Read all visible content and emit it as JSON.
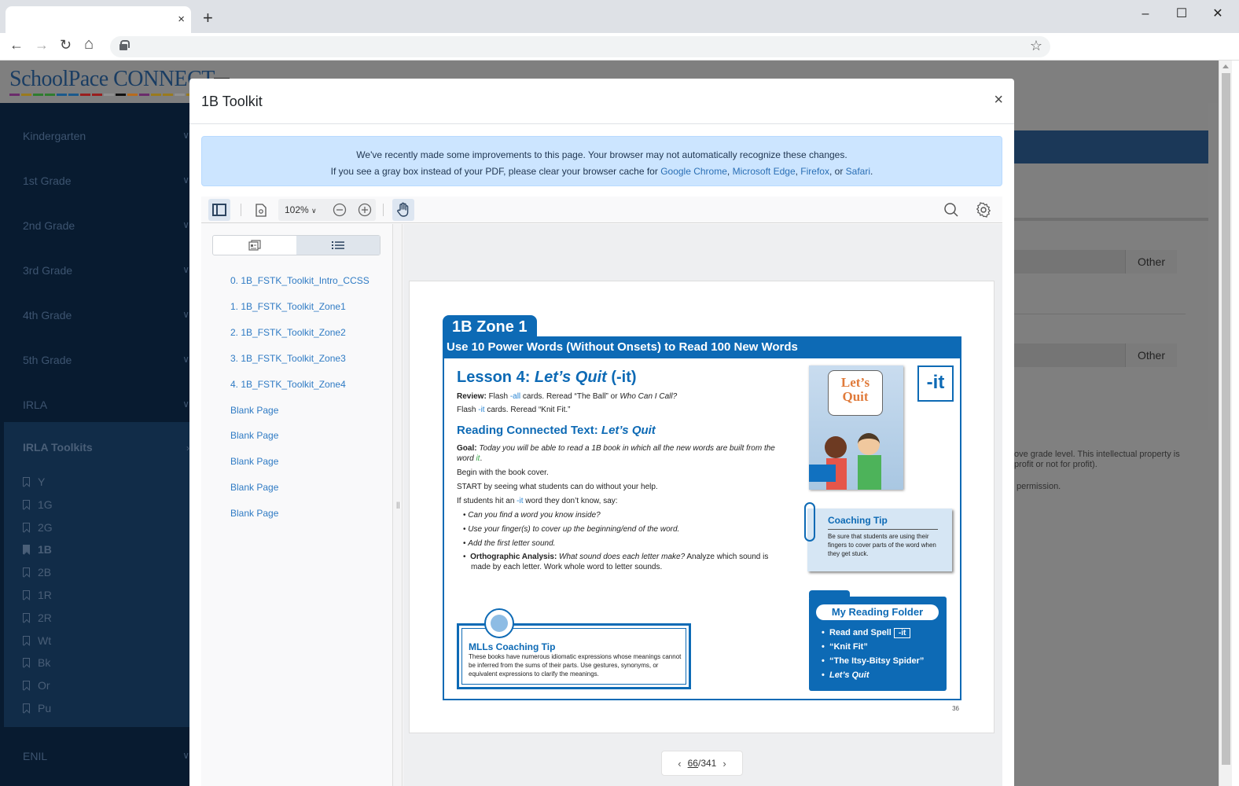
{
  "browser": {
    "tab_title": "",
    "tab_close_icon": "×",
    "new_tab_icon": "+",
    "window_controls": {
      "minimize": "–",
      "maximize": "☐",
      "close": "✕"
    },
    "nav": {
      "back": "←",
      "forward": "→",
      "reload": "↻",
      "home": "⌂"
    },
    "address": "",
    "bookmark_icon": "☆"
  },
  "app": {
    "logo_text": "SchoolPace CONNECT",
    "logo_stripe_colors": [
      "#6b2c6b",
      "#9a7a1e",
      "#2f7d2f",
      "#2f7d2f",
      "#1b5a8c",
      "#1b5a8c",
      "#9a1e1e",
      "#9a1e1e",
      "#909090",
      "#111111",
      "#b86b1e",
      "#6b2c6b",
      "#9a7a1e",
      "#9a7a1e",
      "#909090",
      "#9a7a1e"
    ],
    "sidebar": {
      "sections": [
        {
          "label": "Kindergarten"
        },
        {
          "label": "1st Grade"
        },
        {
          "label": "2nd Grade"
        },
        {
          "label": "3rd Grade"
        },
        {
          "label": "4th Grade"
        },
        {
          "label": "5th Grade"
        },
        {
          "label": "IRLA"
        }
      ],
      "toolkits": {
        "title": "IRLA Toolkits",
        "items": [
          {
            "label": "Y",
            "active": false
          },
          {
            "label": "1G",
            "active": false
          },
          {
            "label": "2G",
            "active": false
          },
          {
            "label": "1B",
            "active": true
          },
          {
            "label": "2B",
            "active": false
          },
          {
            "label": "1R",
            "active": false
          },
          {
            "label": "2R",
            "active": false
          },
          {
            "label": "Wt",
            "active": false
          },
          {
            "label": "Bk",
            "active": false
          },
          {
            "label": "Or",
            "active": false
          },
          {
            "label": "Pu",
            "active": false
          }
        ]
      },
      "after": [
        {
          "label": "ENIL"
        }
      ]
    },
    "main": {
      "other_button_1": "Other",
      "other_button_2": "Other",
      "footer_line_1": "ove grade level. This intellectual property is",
      "footer_line_2": "profit or not for profit).",
      "footer_line_3": "permission."
    }
  },
  "modal": {
    "title": "1B Toolkit",
    "close_icon": "×",
    "alert": {
      "line1": "We've recently made some improvements to this page. Your browser may not automatically recognize these changes.",
      "line2_prefix": "If you see a gray box instead of your PDF, please clear your browser cache for ",
      "links": [
        "Google Chrome",
        "Microsoft Edge",
        "Firefox",
        "Safari"
      ],
      "sep1": ", ",
      "sep2": ", ",
      "sep3": ", or ",
      "suffix": "."
    }
  },
  "viewer": {
    "zoom_level": "102%",
    "outline": [
      "0. 1B_FSTK_Toolkit_Intro_CCSS",
      "1. 1B_FSTK_Toolkit_Zone1",
      "2. 1B_FSTK_Toolkit_Zone2",
      "3. 1B_FSTK_Toolkit_Zone3",
      "4. 1B_FSTK_Toolkit_Zone4",
      "Blank Page",
      "Blank Page",
      "Blank Page",
      "Blank Page",
      "Blank Page"
    ],
    "pager": {
      "current": "66",
      "sep": "/",
      "total": "341"
    }
  },
  "pdf": {
    "zone_tab": "1B Zone 1",
    "zone_bar": "Use 10 Power Words (Without Onsets) to Read 100 New Words",
    "lesson_prefix": "Lesson 4: ",
    "lesson_title": "Let’s Quit",
    "lesson_suffix": " (-it)",
    "review_label": "Review:",
    "review_a": " Flash ",
    "review_hl": "-all",
    "review_b": " cards. Reread “The Ball” or ",
    "review_it": "Who Can I Call?",
    "flash_a": "Flash ",
    "flash_hl": "-it",
    "flash_b": " cards. Reread “Knit Fit.”",
    "rct_prefix": "Reading Connected Text: ",
    "rct_title": "Let’s Quit",
    "goal_label": "Goal:",
    "goal_text": " Today you will be able to read a 1B book in which all the new words are built from the",
    "goal_line2_a": "word ",
    "goal_line2_hl": "it",
    "goal_line2_b": ".",
    "begin": "Begin with the book cover.",
    "start": "START by seeing what students can do without your help.",
    "if_a": "If students hit an ",
    "if_hl": "-it",
    "if_b": " word they don’t know, say:",
    "bullets": [
      "Can you find a word you know inside?",
      "Use your finger(s) to cover up the beginning/end of the word.",
      "Add the first letter sound."
    ],
    "ortho_label": "Orthographic Analysis:",
    "ortho_q": " What sound does each letter make?",
    "ortho_rest": " Analyze which sound is",
    "ortho_line2": "made by each letter. Work whole word to letter sounds.",
    "cover_title": "Let’s Quit",
    "it_box": "-it",
    "coach_title": "Coaching Tip",
    "coach_text": "Be sure that students are using their fingers to cover parts of the word when they get stuck.",
    "folder_title": "My Reading Folder",
    "folder_items": [
      "Read and Spell",
      "“Knit Fit”",
      "“The Itsy-Bitsy Spider”",
      "Let’s Quit"
    ],
    "folder_box": "-it",
    "mll_title": "MLLs Coaching Tip",
    "mll_text": "These books have numerous idiomatic expressions whose meanings cannot be inferred from the sums of their parts. Use gestures, synonyms, or equivalent expressions to clarify the meanings.",
    "page_number": "36"
  },
  "colors": {
    "brand_blue": "#0d6ab5",
    "link_blue": "#2f7bc4",
    "alert_bg": "#cce5ff",
    "sidebar_bg": "#081b30"
  }
}
